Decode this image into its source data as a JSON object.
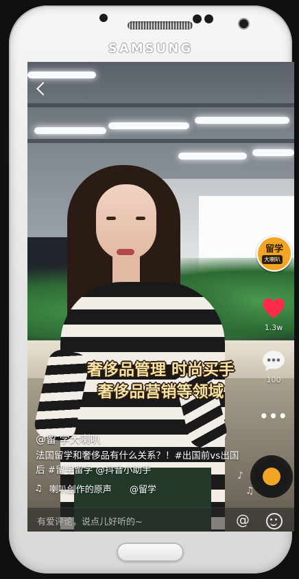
{
  "device": {
    "brand": "SAMSUNG"
  },
  "video": {
    "caption_lines": [
      "奢侈品管理 时尚买手",
      "奢侈品营销等领域"
    ],
    "author": "@留 学大喇叭",
    "description": "法国留学和奢侈品有什么关系？！#出国前vs出国后 #留学留学 @抖音小助手",
    "music": "喇叭创作的原声",
    "music_author": "@留学",
    "badge_top": "留学",
    "badge_bottom": "大喇叭"
  },
  "actions": {
    "likes": "1.3w",
    "comments": "100",
    "more": "•••"
  },
  "comment_bar": {
    "placeholder": "有爱评论，说点儿好听的~",
    "at_symbol": "@"
  },
  "colors": {
    "like_red": "#ff2b4b",
    "caption_yellow": "#f6e2a2",
    "badge_orange": "#f2a524"
  },
  "icons": [
    "back-icon",
    "heart-icon",
    "comment-icon",
    "more-icon",
    "music-note-icon",
    "at-icon",
    "emoji-icon",
    "music-disc-icon"
  ]
}
